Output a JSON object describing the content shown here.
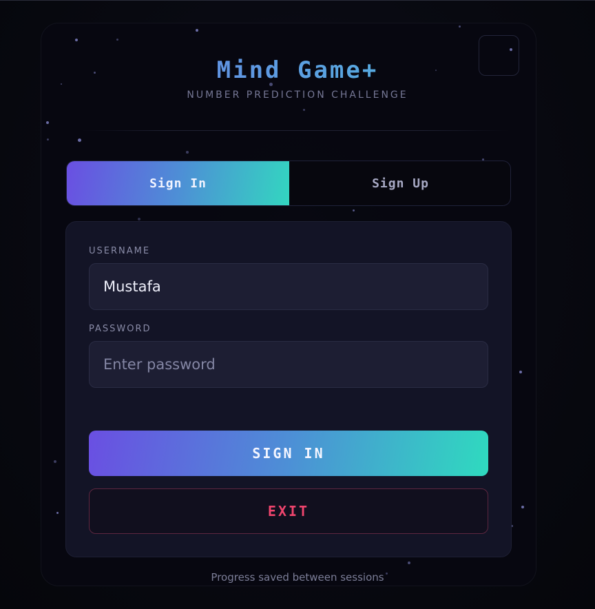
{
  "app": {
    "title": "Mind Game+",
    "subtitle": "NUMBER PREDICTION CHALLENGE"
  },
  "tabs": [
    {
      "label": "Sign In",
      "active": true
    },
    {
      "label": "Sign Up",
      "active": false
    }
  ],
  "form": {
    "username": {
      "label": "USERNAME",
      "value": "Mustafa",
      "placeholder": ""
    },
    "password": {
      "label": "PASSWORD",
      "value": "",
      "placeholder": "Enter password"
    },
    "submit_label": "SIGN IN",
    "exit_label": "EXIT"
  },
  "footer": {
    "note": "Progress saved between sessions"
  },
  "icons": {
    "corner": "blank-square-icon"
  },
  "colors": {
    "accent_start": "#6a4fe2",
    "accent_end": "#2fdabf",
    "danger": "#f0456e",
    "background": "#080910",
    "panel": "#131426"
  }
}
